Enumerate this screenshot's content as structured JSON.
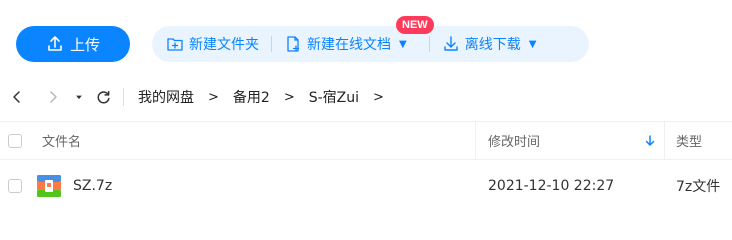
{
  "toolbar": {
    "upload_label": "上传",
    "new_folder_label": "新建文件夹",
    "new_online_doc_label": "新建在线文档",
    "new_badge": "NEW",
    "offline_download_label": "离线下载"
  },
  "breadcrumb": {
    "items": [
      "我的网盘",
      "备用2",
      "S-宿Zui"
    ],
    "separator": ">"
  },
  "table": {
    "headers": {
      "name": "文件名",
      "modified": "修改时间",
      "type": "类型"
    },
    "rows": [
      {
        "name": "SZ.7z",
        "modified": "2021-12-10 22:27",
        "type": "7z文件",
        "icon": "archive-icon"
      }
    ]
  },
  "colors": {
    "accent": "#0a84ff",
    "accent_light": "#eaf4ff",
    "badge": "#ff3b5c"
  }
}
